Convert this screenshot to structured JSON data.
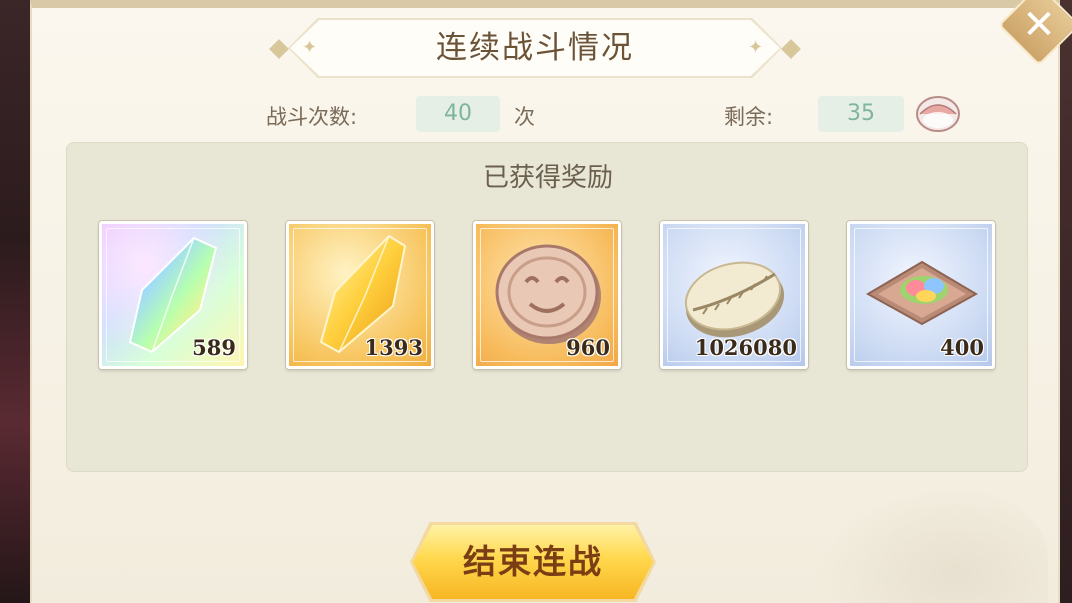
{
  "dialog": {
    "title": "连续战斗情况",
    "close_icon": "close-icon"
  },
  "stats": {
    "battles_label": "战斗次数:",
    "battles_value": "40",
    "battles_unit": "次",
    "remaining_label": "剩余:",
    "remaining_value": "35",
    "remaining_icon": "stamina-icon"
  },
  "rewards": {
    "title": "已获得奖励",
    "items": [
      {
        "icon": "rainbow-crystal-icon",
        "count": "589"
      },
      {
        "icon": "gold-crystal-icon",
        "count": "1393"
      },
      {
        "icon": "coin-icon",
        "count": "960"
      },
      {
        "icon": "cowrie-shell-icon",
        "count": "1026080"
      },
      {
        "icon": "cloth-bundle-icon",
        "count": "400"
      }
    ]
  },
  "actions": {
    "end_button_label": "结束连战"
  },
  "colors": {
    "title_text": "#6b5338",
    "value_text": "#7fb59a",
    "button_gold": "#ffd84d",
    "button_text": "#7a3d14"
  }
}
